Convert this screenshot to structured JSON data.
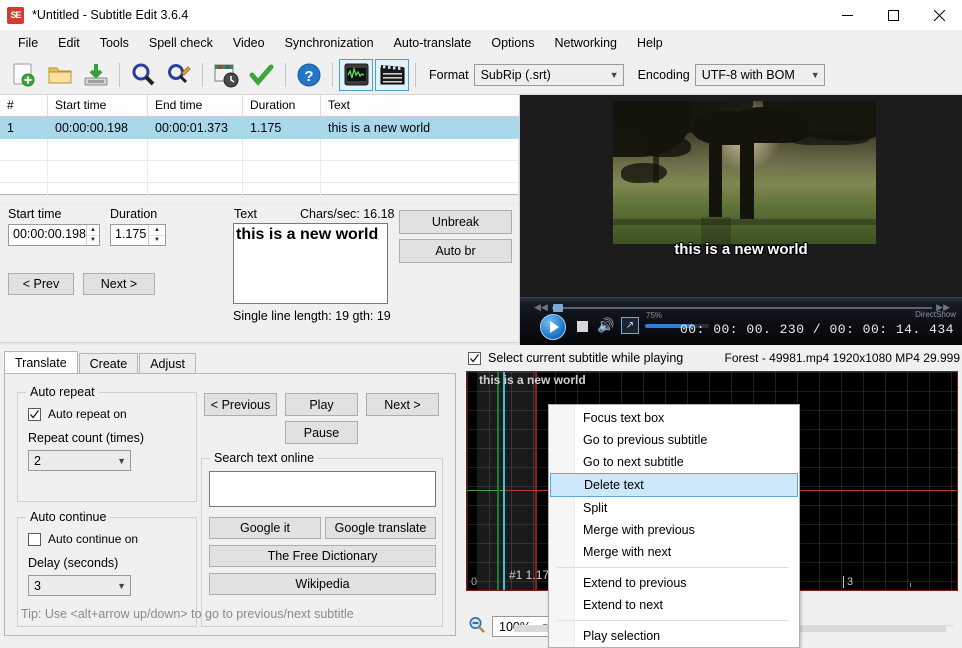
{
  "window": {
    "title": "*Untitled - Subtitle Edit 3.6.4",
    "app_icon": "subtitle-edit-icon",
    "minimize": "—",
    "maximize": "□",
    "close": "✕"
  },
  "menubar": {
    "items": [
      {
        "label": "File"
      },
      {
        "label": "Edit"
      },
      {
        "label": "Tools"
      },
      {
        "label": "Spell check"
      },
      {
        "label": "Video"
      },
      {
        "label": "Synchronization"
      },
      {
        "label": "Auto-translate"
      },
      {
        "label": "Options"
      },
      {
        "label": "Networking"
      },
      {
        "label": "Help"
      }
    ]
  },
  "toolbar": {
    "icons": [
      {
        "name": "new-file-icon"
      },
      {
        "name": "open-folder-icon"
      },
      {
        "name": "save-icon"
      },
      {
        "name": "find-icon"
      },
      {
        "name": "replace-icon"
      },
      {
        "name": "sync-time-icon"
      },
      {
        "name": "spell-check-icon"
      },
      {
        "name": "help-icon"
      },
      {
        "name": "waveform-toggle-icon"
      },
      {
        "name": "video-toggle-icon"
      }
    ],
    "format_label": "Format",
    "format_value": "SubRip (.srt)",
    "encoding_label": "Encoding",
    "encoding_value": "UTF-8 with BOM"
  },
  "subtitle_grid": {
    "columns": [
      "#",
      "Start time",
      "End time",
      "Duration",
      "Text"
    ],
    "rows": [
      {
        "number": "1",
        "start": "00:00:00.198",
        "end": "00:00:01.373",
        "duration": "1.175",
        "text": "this is a new world",
        "selected": true
      }
    ]
  },
  "editor": {
    "start_time_label": "Start time",
    "start_time_value": "00:00:00.198",
    "duration_label": "Duration",
    "duration_value": "1.175",
    "prev_button": "< Prev",
    "next_button": "Next >",
    "text_label": "Text",
    "chars_per_sec": "Chars/sec: 16.18",
    "text_value": "this is a new world",
    "length_status": "Single line length: 19 gth: 19",
    "unbreak_button": "Unbreak",
    "autobr_button": "Auto br"
  },
  "video_player": {
    "caption": "this is a new world",
    "play_icon": "play-icon",
    "stop_icon": "stop-icon",
    "volume_icon": "speaker-icon",
    "fullscreen_icon": "fullscreen-icon",
    "volume_percent": "75%",
    "engine": "DirectShow",
    "position": "00: 00: 00. 230",
    "separator": "/",
    "total": "00: 00: 14. 434"
  },
  "tabs": {
    "items": [
      {
        "label": "Translate",
        "active": true
      },
      {
        "label": "Create",
        "active": false
      },
      {
        "label": "Adjust",
        "active": false
      }
    ]
  },
  "translate_panel": {
    "auto_repeat_group": "Auto repeat",
    "auto_repeat_checkbox": "Auto repeat on",
    "auto_repeat_checked": true,
    "repeat_count_label": "Repeat count (times)",
    "repeat_count_value": "2",
    "auto_continue_group": "Auto continue",
    "auto_continue_checkbox": "Auto continue on",
    "auto_continue_checked": false,
    "delay_label": "Delay (seconds)",
    "delay_value": "3",
    "previous_button": "< Previous",
    "play_button": "Play",
    "next_button": "Next >",
    "pause_button": "Pause",
    "search_group": "Search text online",
    "search_value": "",
    "google_it_button": "Google it",
    "google_translate_button": "Google translate",
    "free_dictionary_button": "The Free Dictionary",
    "wikipedia_button": "Wikipedia",
    "tip": "Tip: Use <alt+arrow up/down> to go to previous/next subtitle"
  },
  "waveform": {
    "select_checkbox": "Select current subtitle while playing",
    "select_checked": true,
    "file_info": "Forest - 49981.mp4 1920x1080 MP4 29.999",
    "subtitle_label": "this is a new world",
    "region_info": "#1  1.17",
    "time_start": "0",
    "time_mark": "3",
    "zoom_icon": "zoom-out-icon",
    "zoom_value": "100%"
  },
  "context_menu": {
    "items": [
      {
        "label": "Focus text box",
        "highlighted": false,
        "separator_after": false
      },
      {
        "label": "Go to previous subtitle",
        "highlighted": false,
        "separator_after": false
      },
      {
        "label": "Go to next subtitle",
        "highlighted": false,
        "separator_after": false
      },
      {
        "label": "Delete text",
        "highlighted": true,
        "separator_after": false
      },
      {
        "label": "Split",
        "highlighted": false,
        "separator_after": false
      },
      {
        "label": "Merge with previous",
        "highlighted": false,
        "separator_after": false
      },
      {
        "label": "Merge with next",
        "highlighted": false,
        "separator_after": true
      },
      {
        "label": "Extend to previous",
        "highlighted": false,
        "separator_after": false
      },
      {
        "label": "Extend to next",
        "highlighted": false,
        "separator_after": true
      },
      {
        "label": "Play selection",
        "highlighted": false,
        "separator_after": false
      }
    ]
  },
  "colors": {
    "selection_blue": "#a8d8ea",
    "menu_highlight": "#cde8f9",
    "waveform_border": "#7d1a1a",
    "accent_blue": "#4a9fd4"
  }
}
